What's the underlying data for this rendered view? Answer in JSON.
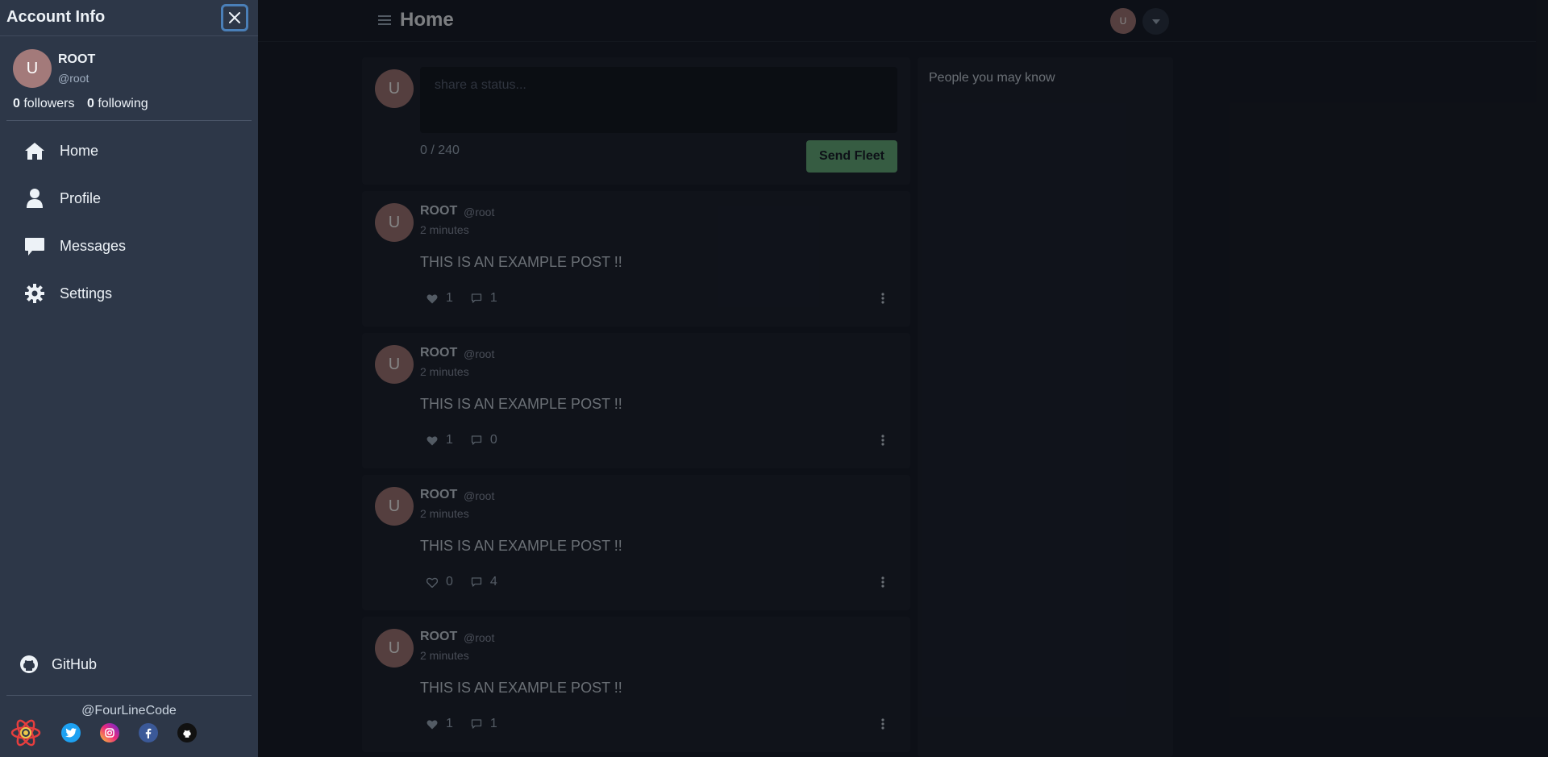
{
  "header": {
    "title": "Home",
    "avatar_initial": "U"
  },
  "composer": {
    "avatar_initial": "U",
    "placeholder": "share a status...",
    "counter": "0 / 240",
    "send_label": "Send Fleet"
  },
  "posts": [
    {
      "name": "ROOT",
      "handle": "@root",
      "time": "2 minutes",
      "text": "THIS IS AN EXAMPLE POST !!",
      "likes": "1",
      "liked": true,
      "comments": "1"
    },
    {
      "name": "ROOT",
      "handle": "@root",
      "time": "2 minutes",
      "text": "THIS IS AN EXAMPLE POST !!",
      "likes": "1",
      "liked": true,
      "comments": "0"
    },
    {
      "name": "ROOT",
      "handle": "@root",
      "time": "2 minutes",
      "text": "THIS IS AN EXAMPLE POST !!",
      "likes": "0",
      "liked": false,
      "comments": "4"
    },
    {
      "name": "ROOT",
      "handle": "@root",
      "time": "2 minutes",
      "text": "THIS IS AN EXAMPLE POST !!",
      "likes": "1",
      "liked": true,
      "comments": "1"
    }
  ],
  "sidebar_right": {
    "heading": "People you may know"
  },
  "drawer": {
    "title": "Account Info",
    "avatar_initial": "U",
    "name": "ROOT",
    "handle": "@root",
    "followers_count": "0",
    "followers_label": "followers",
    "following_count": "0",
    "following_label": "following",
    "nav": [
      {
        "label": "Home",
        "icon": "home-icon"
      },
      {
        "label": "Profile",
        "icon": "user-icon"
      },
      {
        "label": "Messages",
        "icon": "message-icon"
      },
      {
        "label": "Settings",
        "icon": "gear-icon"
      }
    ],
    "github_label": "GitHub",
    "credit": "@FourLineCode",
    "socials": [
      "react-icon",
      "twitter-icon",
      "instagram-icon",
      "facebook-icon",
      "github-icon"
    ]
  },
  "colors": {
    "accent_green": "#68b07f",
    "avatar_bg": "#a37a7a",
    "drawer_bg": "#2d3748",
    "page_bg": "#1a202c"
  }
}
